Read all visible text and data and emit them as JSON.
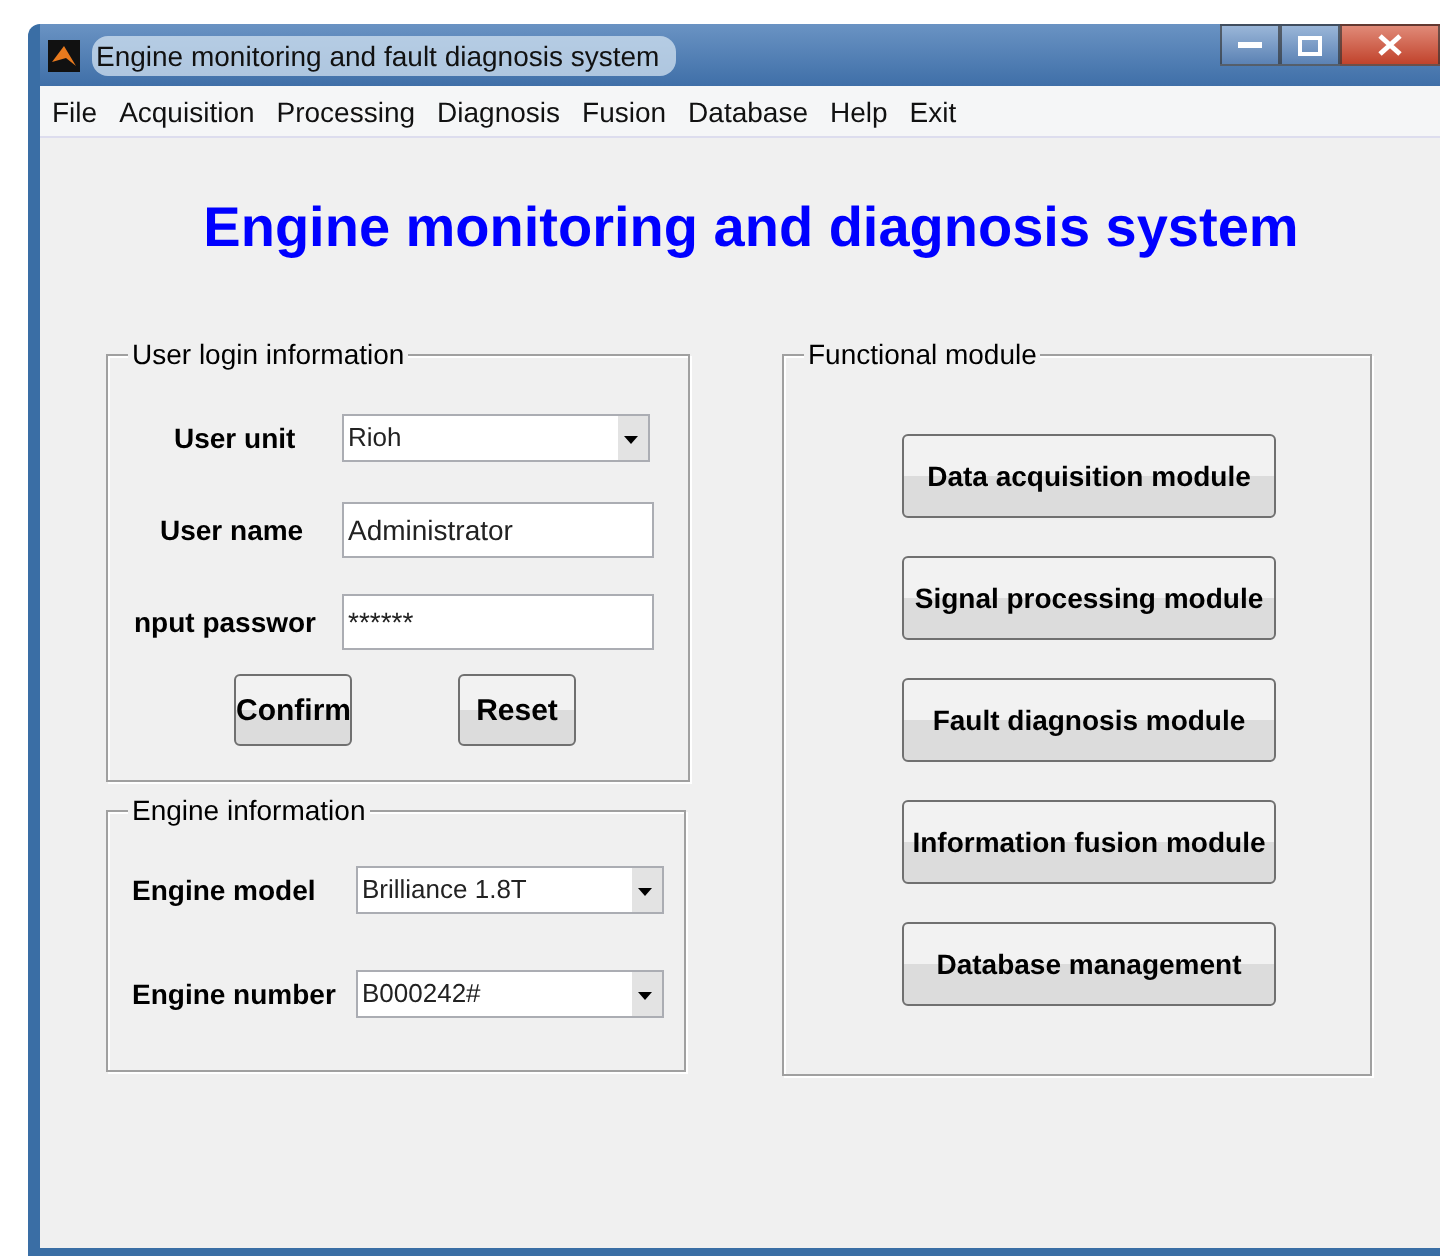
{
  "window": {
    "title": "Engine monitoring and fault diagnosis system"
  },
  "menu": [
    "File",
    "Acquisition",
    "Processing",
    "Diagnosis",
    "Fusion",
    "Database",
    "Help",
    "Exit"
  ],
  "heading": "Engine monitoring and diagnosis system",
  "login": {
    "title": "User login information",
    "fields": [
      {
        "kind": "dropdown",
        "label": "User unit",
        "value": "Rioh"
      },
      {
        "kind": "text",
        "label": "User name",
        "value": "Administrator"
      },
      {
        "kind": "text",
        "label": "nput passwor",
        "value": "******"
      }
    ],
    "buttons": [
      "Confirm",
      "Reset"
    ]
  },
  "engine": {
    "title": "Engine information",
    "fields": [
      {
        "kind": "dropdown",
        "label": "Engine model",
        "value": "Brilliance 1.8T"
      },
      {
        "kind": "dropdown",
        "label": "Engine number",
        "value": "B000242#"
      }
    ]
  },
  "modules": {
    "title": "Functional module",
    "buttons": [
      "Data acquisition module",
      "Signal processing module",
      "Fault diagnosis module",
      "Information fusion module",
      "Database management"
    ]
  }
}
